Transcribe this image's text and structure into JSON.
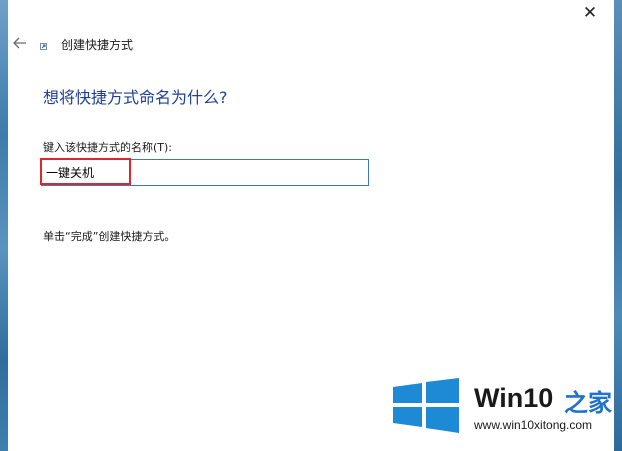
{
  "window": {
    "close_glyph": "✕"
  },
  "wizard": {
    "title": "创建快捷方式",
    "back_icon": "arrow-left-icon",
    "shortcut_icon": "shortcut-icon",
    "heading": "想将快捷方式命名为什么?",
    "name_label": "键入该快捷方式的名称(T):",
    "name_value": "一键关机",
    "hint": "单击“完成”创建快捷方式。"
  },
  "watermark": {
    "brand": "Win10",
    "brand_suffix": "之家",
    "url": "www.win10xitong.com",
    "logo_color": "#1e8ad6"
  },
  "colors": {
    "heading": "#1f3f99",
    "input_border": "#3d7ab8",
    "highlight": "#e0262b"
  }
}
